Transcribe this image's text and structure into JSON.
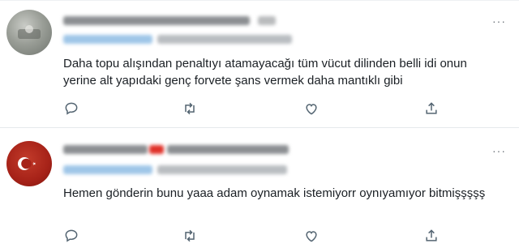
{
  "tweets": [
    {
      "author_name_blurred": true,
      "handle_blurred": true,
      "text": "Daha topu alışından penaltıyı atamayacağı tüm vücut dilinden belli idi onun yerine alt yapıdaki genç forvete şans vermek daha mantıklı gibi",
      "avatar_icon": "gray-avatar",
      "actions": [
        "reply-icon",
        "retweet-icon",
        "like-icon",
        "share-icon"
      ]
    },
    {
      "author_name_blurred": true,
      "handle_blurred": true,
      "text": "Hemen gönderin bunu yaaa adam oynamak istemiyorr oynıyamıyor bitmişşşşş",
      "avatar_icon": "red-crescent-avatar",
      "actions": [
        "reply-icon",
        "retweet-icon",
        "like-icon",
        "share-icon"
      ]
    }
  ],
  "more_label": "···",
  "colors": {
    "icon": "#536471",
    "handle": "#1d9bf0",
    "avatar2": "#b0271a"
  }
}
